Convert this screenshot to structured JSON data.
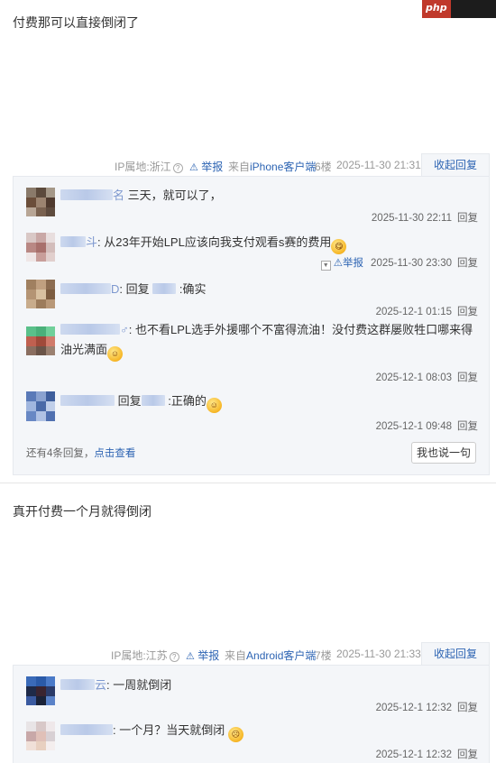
{
  "watermark": "php",
  "posts": [
    {
      "text": "付费那可以直接倒闭了",
      "ip": "IP属地:浙江",
      "report": "举报",
      "client_prefix": "来自",
      "client": "iPhone客户端",
      "floor": "6楼",
      "time": "2025-11-30 21:31",
      "collapse": "收起回复",
      "replies": [
        {
          "name_end": "名",
          "text": " 三天，就可以了，",
          "time": "2025-11-30 22:11",
          "reply": "回复"
        },
        {
          "name_end": "斗",
          "text": ": 从23年开始LPL应该向我支付观看s赛的费用",
          "time": "2025-11-30 23:30",
          "reply": "回复",
          "report": "举报"
        },
        {
          "name_end": "D",
          "text": ": 回复",
          "text2": " :确实",
          "time": "2025-12-1 01:15",
          "reply": "回复"
        },
        {
          "name_end": "♂",
          "text": ": 也不看LPL选手外援哪个不富得流油！没付费这群屡败牲口哪来得油光满面",
          "time": "2025-12-1 08:03",
          "reply": "回复"
        },
        {
          "name_end": "",
          "text": " 回复",
          "text2": " :正确的",
          "time": "2025-12-1 09:48",
          "reply": "回复"
        }
      ],
      "more_prefix": "还有4条回复，",
      "more_link": "点击查看",
      "say": "我也说一句"
    },
    {
      "text": "真开付费一个月就得倒闭",
      "ip": "IP属地:江苏",
      "report": "举报",
      "client_prefix": "来自",
      "client": "Android客户端",
      "floor": "7楼",
      "time": "2025-11-30 21:33",
      "collapse": "收起回复",
      "replies": [
        {
          "name_end": "云",
          "text": ": 一周就倒闭",
          "time": "2025-12-1 12:32",
          "reply": "回复"
        },
        {
          "name_end": "",
          "text": ": 一个月？当天就倒闭",
          "time": "2025-12-1 12:32",
          "reply": "回复"
        }
      ]
    }
  ]
}
